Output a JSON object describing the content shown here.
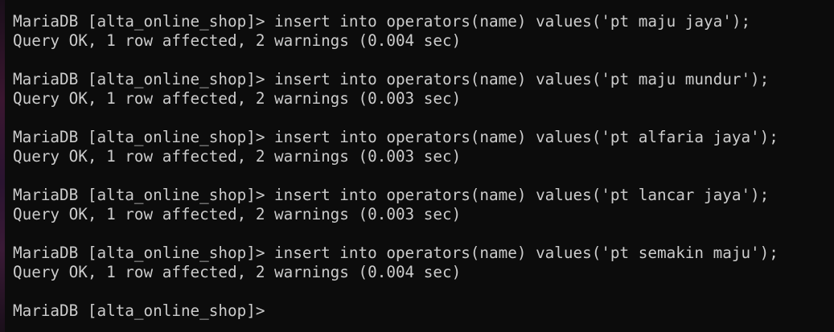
{
  "terminal": {
    "lines": [
      "MariaDB [alta_online_shop]> insert into operators(name) values('pt maju jaya');",
      "Query OK, 1 row affected, 2 warnings (0.004 sec)",
      "MariaDB [alta_online_shop]> insert into operators(name) values('pt maju mundur');",
      "Query OK, 1 row affected, 2 warnings (0.003 sec)",
      "MariaDB [alta_online_shop]> insert into operators(name) values('pt alfaria jaya');",
      "Query OK, 1 row affected, 2 warnings (0.003 sec)",
      "MariaDB [alta_online_shop]> insert into operators(name) values('pt lancar jaya');",
      "Query OK, 1 row affected, 2 warnings (0.003 sec)",
      "MariaDB [alta_online_shop]> insert into operators(name) values('pt semakin maju');",
      "Query OK, 1 row affected, 2 warnings (0.004 sec)",
      "MariaDB [alta_online_shop]>"
    ]
  },
  "colors": {
    "background": "#0c0c0c",
    "text": "#cccccc"
  }
}
